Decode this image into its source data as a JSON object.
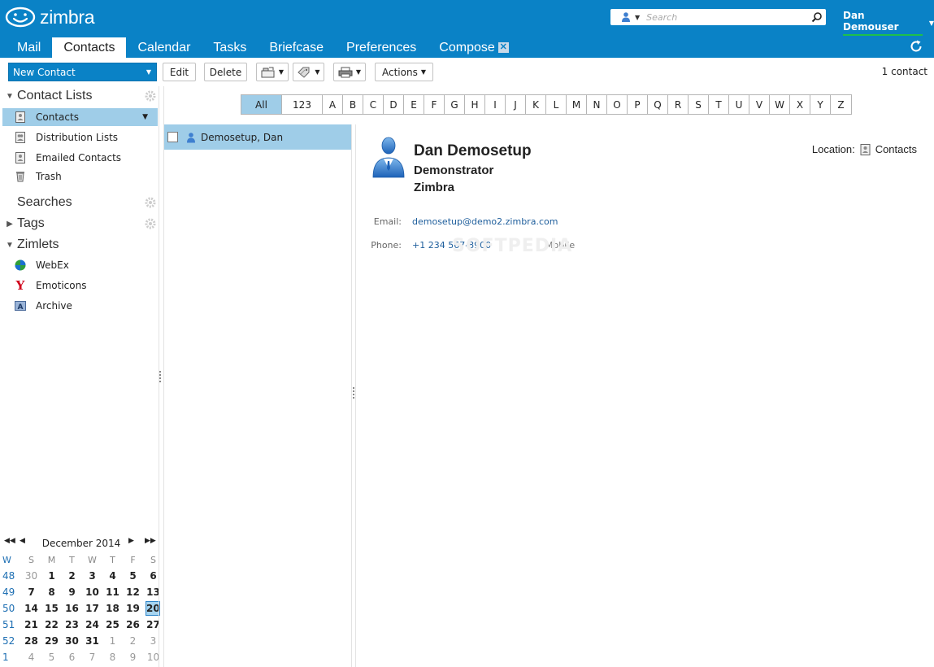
{
  "app": {
    "logo_text": "zimbra",
    "search_placeholder": "Search",
    "user_name": "Dan Demouser"
  },
  "tabs": [
    {
      "label": "Mail"
    },
    {
      "label": "Contacts",
      "active": true
    },
    {
      "label": "Calendar"
    },
    {
      "label": "Tasks"
    },
    {
      "label": "Briefcase"
    },
    {
      "label": "Preferences"
    },
    {
      "label": "Compose",
      "closable": true
    }
  ],
  "toolbar": {
    "new_contact": "New Contact",
    "edit": "Edit",
    "delete": "Delete",
    "actions": "Actions",
    "count": "1 contact"
  },
  "sidebar": {
    "contact_lists_header": "Contact Lists",
    "items": [
      {
        "label": "Contacts",
        "icon": "address-book-icon",
        "selected": true
      },
      {
        "label": "Distribution Lists",
        "icon": "distribution-list-icon"
      },
      {
        "label": "Emailed Contacts",
        "icon": "address-book-icon"
      },
      {
        "label": "Trash",
        "icon": "trash-icon"
      }
    ],
    "searches_header": "Searches",
    "tags_header": "Tags",
    "zimlets_header": "Zimlets",
    "zimlets": [
      {
        "label": "WebEx",
        "icon": "webex-icon"
      },
      {
        "label": "Emoticons",
        "icon": "yahoo-icon"
      },
      {
        "label": "Archive",
        "icon": "archive-icon"
      }
    ]
  },
  "calendar": {
    "month": "December 2014",
    "week_header": "W",
    "day_headers": [
      "S",
      "M",
      "T",
      "W",
      "T",
      "F",
      "S"
    ],
    "weeks": [
      {
        "num": "48",
        "days": [
          "30",
          "1",
          "2",
          "3",
          "4",
          "5",
          "6"
        ]
      },
      {
        "num": "49",
        "days": [
          "7",
          "8",
          "9",
          "10",
          "11",
          "12",
          "13"
        ]
      },
      {
        "num": "50",
        "days": [
          "14",
          "15",
          "16",
          "17",
          "18",
          "19",
          "20"
        ]
      },
      {
        "num": "51",
        "days": [
          "21",
          "22",
          "23",
          "24",
          "25",
          "26",
          "27"
        ]
      },
      {
        "num": "52",
        "days": [
          "28",
          "29",
          "30",
          "31",
          "1",
          "2",
          "3"
        ]
      },
      {
        "num": "1",
        "days": [
          "4",
          "5",
          "6",
          "7",
          "8",
          "9",
          "10"
        ]
      }
    ],
    "today": "20"
  },
  "alphabet": [
    "All",
    "123",
    "A",
    "B",
    "C",
    "D",
    "E",
    "F",
    "G",
    "H",
    "I",
    "J",
    "K",
    "L",
    "M",
    "N",
    "O",
    "P",
    "Q",
    "R",
    "S",
    "T",
    "U",
    "V",
    "W",
    "X",
    "Y",
    "Z"
  ],
  "contacts": [
    {
      "name": "Demosetup, Dan"
    }
  ],
  "detail": {
    "full_name": "Dan Demosetup",
    "job_title": "Demonstrator",
    "company": "Zimbra",
    "location_label": "Location:",
    "location_value": "Contacts",
    "email_label": "Email:",
    "email_value": "demosetup@demo2.zimbra.com",
    "phone_label": "Phone:",
    "phone_value": "+1 234 567-8900",
    "phone_type": "Mobile",
    "watermark": "SOFTPEDIA"
  },
  "colors": {
    "brand": "#0a82c6",
    "selection": "#9fcde8"
  }
}
